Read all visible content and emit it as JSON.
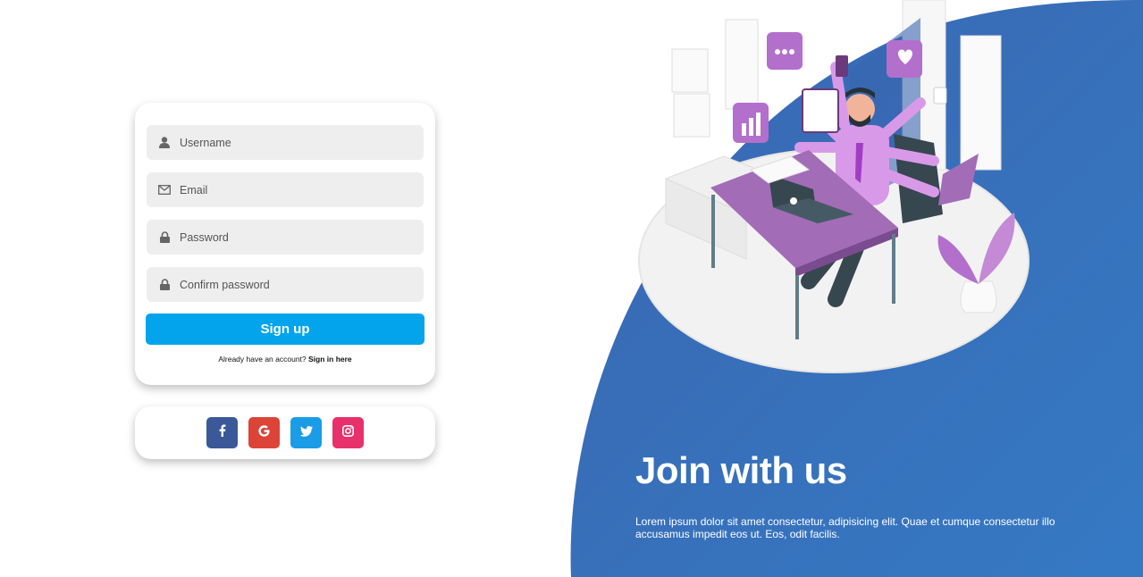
{
  "form": {
    "username_placeholder": "Username",
    "email_placeholder": "Email",
    "password_placeholder": "Password",
    "confirm_placeholder": "Confirm password",
    "signup_label": "Sign up",
    "already_text": "Already have an account? ",
    "signin_link": "Sign in here"
  },
  "social": [
    {
      "name": "facebook",
      "glyph": "f",
      "color": "#3b5998"
    },
    {
      "name": "google",
      "glyph": "G",
      "color": "#db4437"
    },
    {
      "name": "twitter",
      "glyph": "t",
      "color": "#1da1f2"
    },
    {
      "name": "instagram",
      "glyph": "o",
      "color": "#e1306c"
    }
  ],
  "hero": {
    "title": "Join with us",
    "text": "Lorem ipsum dolor sit amet consectetur, adipisicing elit. Quae et cumque consectetur illo accusamus impedit eos ut. Eos, odit facilis."
  },
  "colors": {
    "accent": "#03a4ec",
    "panel_blue": "#3a6db5"
  }
}
